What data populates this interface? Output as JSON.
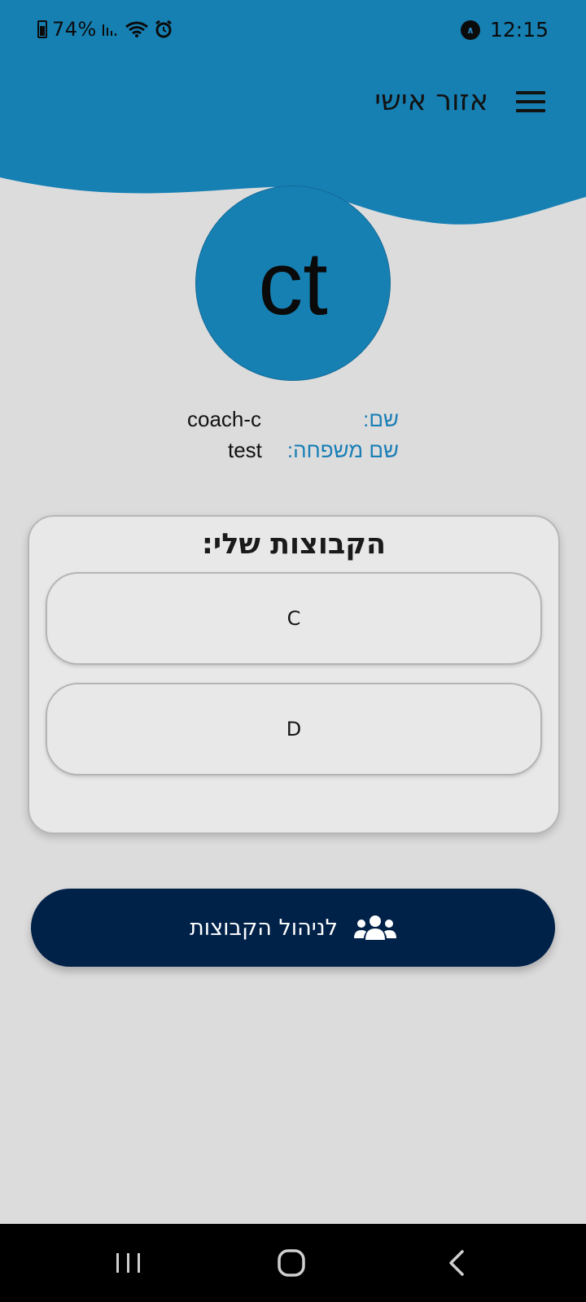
{
  "status_bar": {
    "battery": "74%",
    "time": "12:15"
  },
  "header": {
    "title": "אזור אישי"
  },
  "profile": {
    "initials": "ct",
    "first_name_label": "שם:",
    "first_name_value": "coach-c",
    "last_name_label": "שם משפחה:",
    "last_name_value": "test"
  },
  "groups": {
    "title": "הקבוצות שלי:",
    "items": [
      {
        "label": "C"
      },
      {
        "label": "D"
      }
    ]
  },
  "manage_button": {
    "label": "לניהול הקבוצות",
    "icon": "users-icon"
  },
  "colors": {
    "header_blue": "#1680b3",
    "background": "#dcdcdd",
    "label_blue": "#1a7fb6",
    "button_navy": "#002148"
  }
}
